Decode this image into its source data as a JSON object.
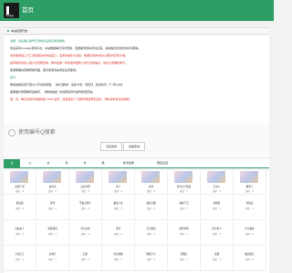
{
  "header": {
    "logo_text": "melage",
    "title": "首页"
  },
  "banner": {
    "text": "本站权限开放"
  },
  "notice": {
    "lines": [
      {
        "text": "说明：请先确认账号已登录并设置好游戏角色",
        "cls": "sec-label"
      },
      {
        "text": "欢迎来到melage查询平台，本站数据每日同步更新，若数据有误请及时反馈，感谢各位玩家的支持与帮助。",
        "cls": ""
      },
      {
        "text": "请勿使用第三方工具批量请求本站接口，违者将被永久封禁，数据仅供参考请以游戏内实际为准。",
        "cls": "warn"
      },
      {
        "text": "如有疑问请加入官方交流群咨询，群内会第一时间发布更新公告与活动信息，欢迎大家踊跃参与。",
        "cls": "warn"
      },
      {
        "text": "使用教程请查看帮助页面，首次使用请先阅读注意事项。",
        "cls": ""
      },
      {
        "text": "提示：",
        "cls": "sec-label"
      },
      {
        "text": "角色数据来源于官方公开资料整理，【本日更新】  最新卡池：【限定】  活动时间：【一周以内】",
        "cls": ""
      },
      {
        "text": "结果展示按照稀有度排序，【角色档案】支持按名称与编号搜索查询。",
        "cls": ""
      },
      {
        "text": "第一天：每日签到可领取奖励 1000 金币，连续签到 7 天额外赠送限定道具，详情请参考活动说明。",
        "cls": "warn"
      }
    ]
  },
  "search": {
    "placeholder": "使用编号Q搜索",
    "btn1": "高级选项",
    "btn2": "批量查询"
  },
  "tabs": [
    "全",
    "火",
    "水",
    "风",
    "光",
    "暗",
    "新手指南",
    "限定反馈"
  ],
  "cards": [
    {
      "name": "在原千里",
      "cost": "费用：6"
    },
    {
      "name": "白华天",
      "cost": "费用：5"
    },
    {
      "name": "灵音雪原",
      "cost": "费用：6"
    },
    {
      "name": "花鸟",
      "cost": "费用：4"
    },
    {
      "name": "双月",
      "cost": "费用：5"
    },
    {
      "name": "苍穹之守望者",
      "cost": "费用：7"
    },
    {
      "name": "刀剑人",
      "cost": "费用：3"
    },
    {
      "name": "狮鹫王",
      "cost": "费用：6"
    },
    {
      "name": "骑兵团",
      "cost": "费用：5"
    },
    {
      "name": "苍雪",
      "cost": "费用：4"
    },
    {
      "name": "圣夜之骑士",
      "cost": "费用：6"
    },
    {
      "name": "魔法少女",
      "cost": "费用：5"
    },
    {
      "name": "银色之翼",
      "cost": "费用：4"
    },
    {
      "name": "森林守卫",
      "cost": "费用：3"
    },
    {
      "name": "剑舞者",
      "cost": "费用：5"
    },
    {
      "name": "赤焰龙",
      "cost": "费用：7"
    },
    {
      "name": "冰晶女王",
      "cost": "费用：6"
    },
    {
      "name": "雷霆使者",
      "cost": "费用：5"
    },
    {
      "name": "月之巫女",
      "cost": "费用：4"
    },
    {
      "name": "星辰",
      "cost": "费用：5"
    },
    {
      "name": "光之精灵",
      "cost": "费用：3"
    },
    {
      "name": "暗影刺客",
      "cost": "费用：5"
    },
    {
      "name": "风之旅人",
      "cost": "费用：4"
    },
    {
      "name": "炎之魔女",
      "cost": "费用：6"
    },
    {
      "name": "沙漠之王",
      "cost": "费用：5"
    },
    {
      "name": "龙骑士",
      "cost": "费用：7"
    },
    {
      "name": "幻影",
      "cost": "费用：4"
    },
    {
      "name": "海之歌姬",
      "cost": "费用：5"
    },
    {
      "name": "钢铁卫士",
      "cost": "费用：6"
    },
    {
      "name": "黑曜石",
      "cost": "费用：5"
    },
    {
      "name": "灵狐",
      "cost": "费用：3"
    },
    {
      "name": "幽灵船长",
      "cost": "费用：6"
    }
  ],
  "colors": {
    "primary": "#2f9e66",
    "warning": "#d93025"
  }
}
